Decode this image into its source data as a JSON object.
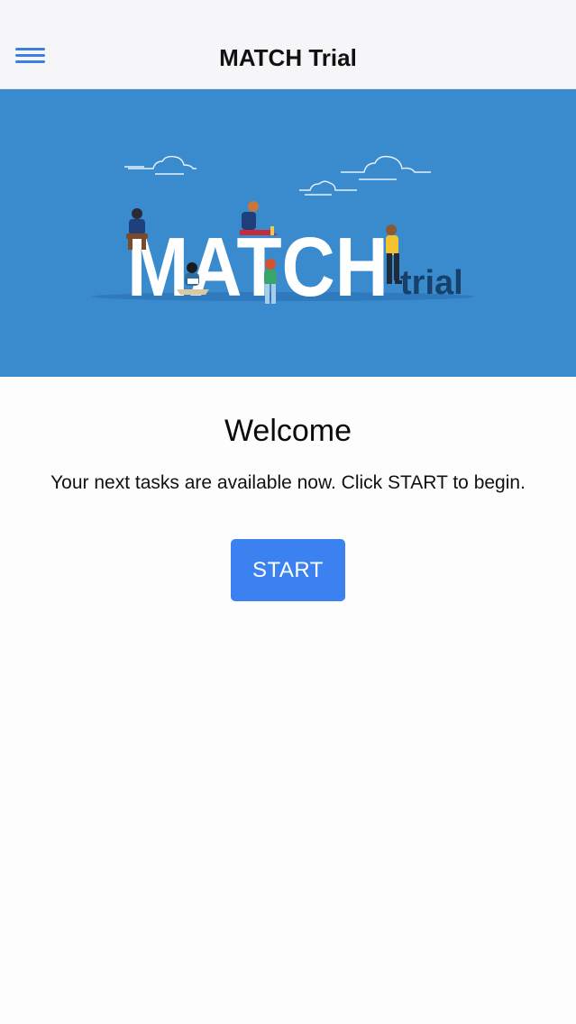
{
  "header": {
    "title": "MATCH Trial",
    "menu_icon": "hamburger-menu-icon"
  },
  "banner": {
    "logo_main": "MATCH",
    "logo_sub": "trial",
    "background_color": "#3a8ace"
  },
  "main": {
    "heading": "Welcome",
    "message": "Your next tasks are available now. Click START to begin.",
    "start_label": "START"
  },
  "colors": {
    "accent": "#3b82f0",
    "menu_icon": "#3b7fe3"
  }
}
